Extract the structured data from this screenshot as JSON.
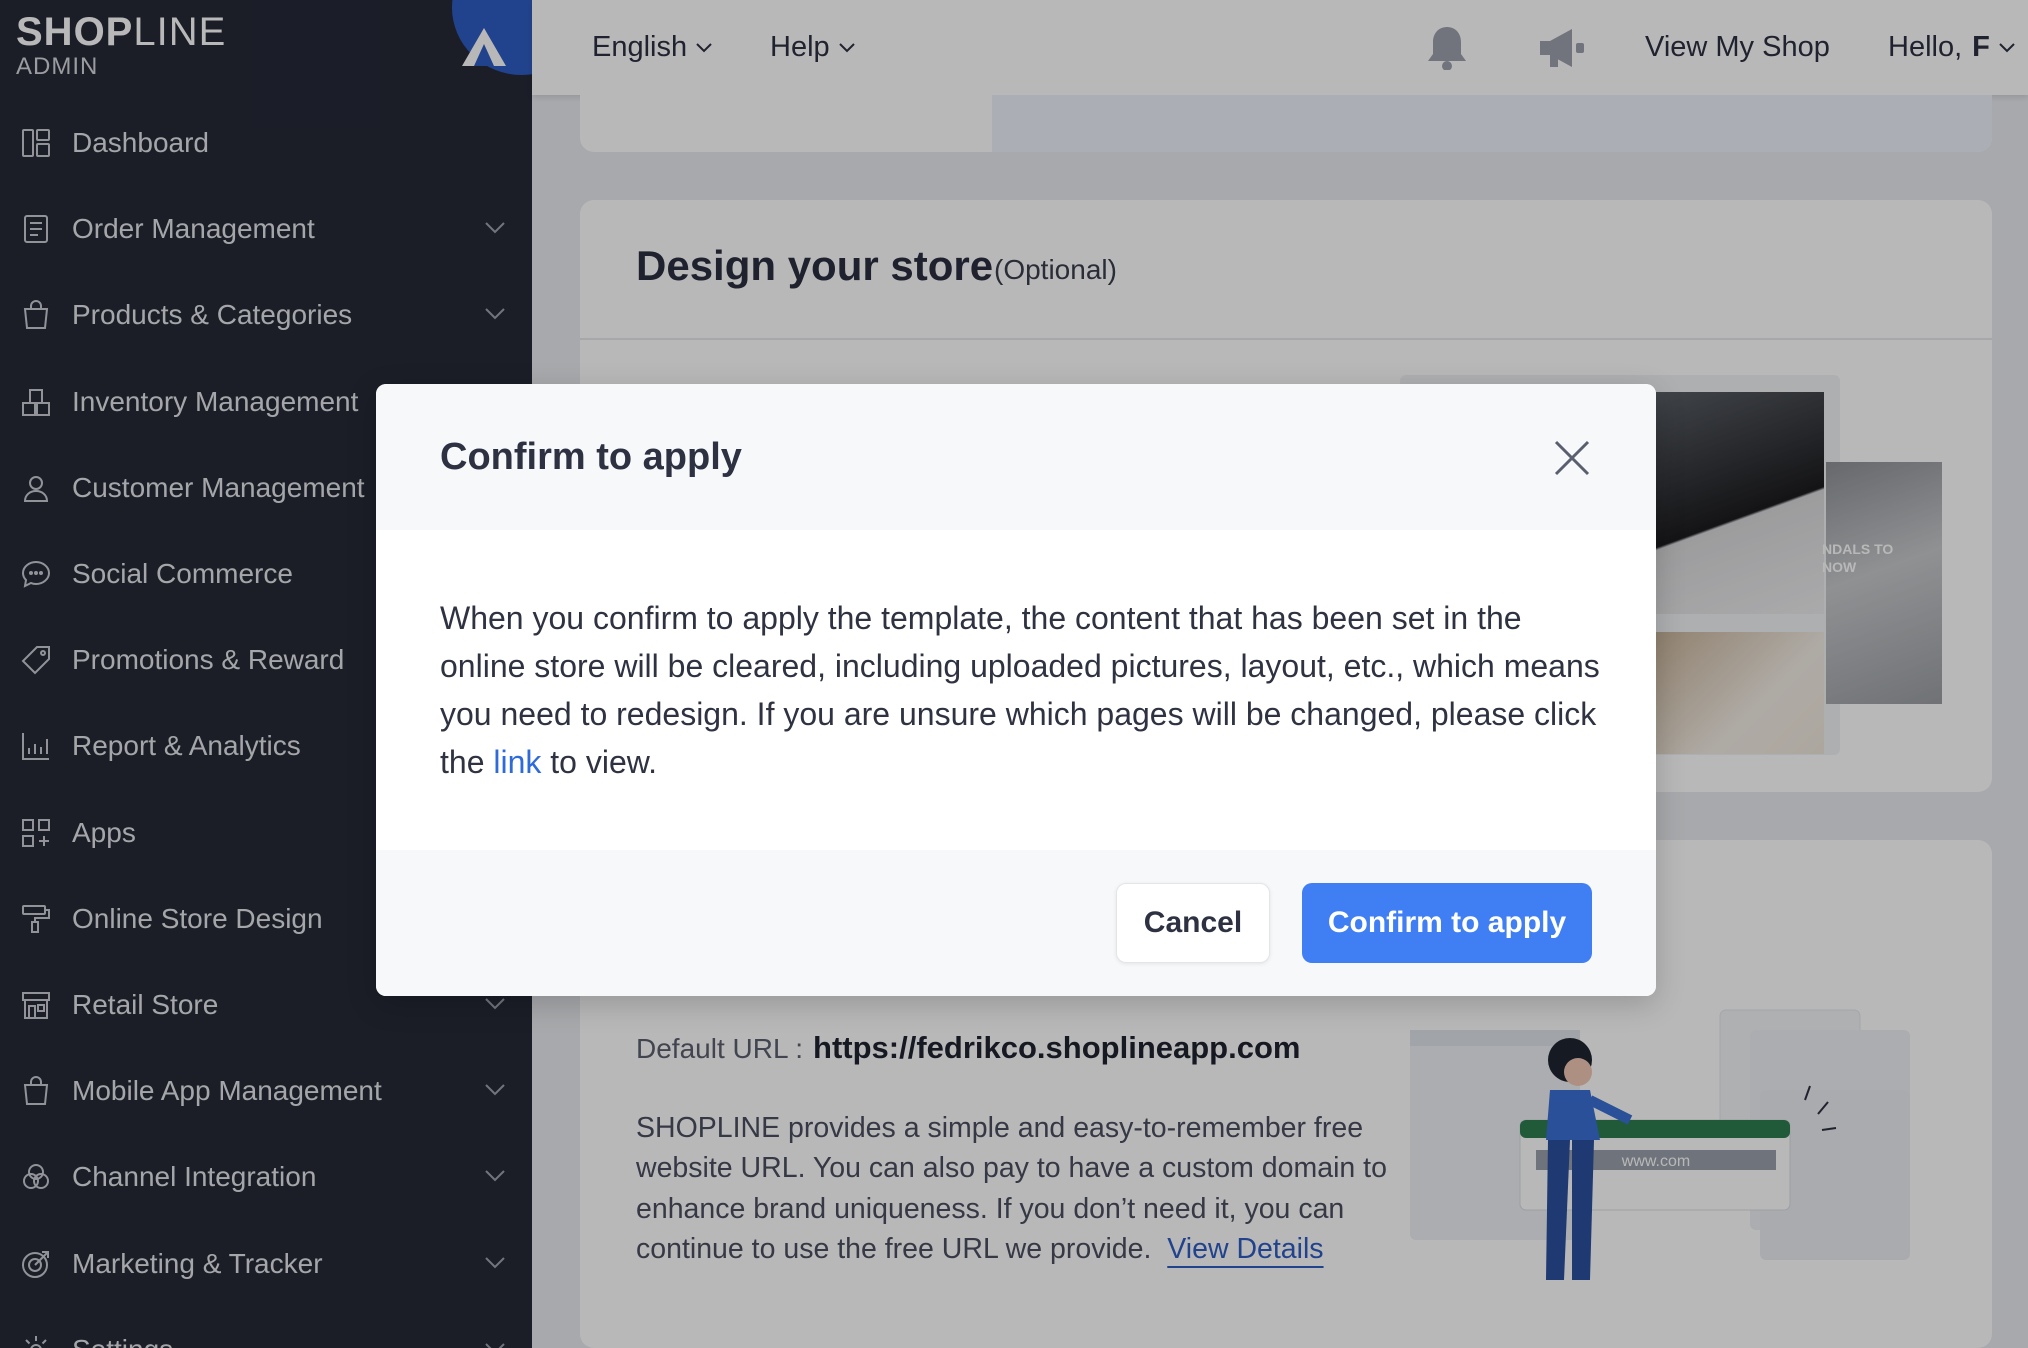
{
  "sidebar": {
    "logo": {
      "main_bold": "SHOP",
      "main_light": "LINE",
      "sub": "ADMIN"
    },
    "items": [
      {
        "label": "Dashboard",
        "icon": "dashboard-icon",
        "expandable": false
      },
      {
        "label": "Order Management",
        "icon": "document-icon",
        "expandable": true
      },
      {
        "label": "Products & Categories",
        "icon": "bag-icon",
        "expandable": true
      },
      {
        "label": "Inventory Management",
        "icon": "boxes-icon",
        "expandable": true
      },
      {
        "label": "Customer Management",
        "icon": "person-icon",
        "expandable": true
      },
      {
        "label": "Social Commerce",
        "icon": "chat-icon",
        "expandable": true
      },
      {
        "label": "Promotions & Reward",
        "icon": "tag-icon",
        "expandable": true
      },
      {
        "label": "Report & Analytics",
        "icon": "analytics-icon",
        "expandable": true
      },
      {
        "label": "Apps",
        "icon": "apps-grid-icon",
        "expandable": false
      },
      {
        "label": "Online Store Design",
        "icon": "paint-roller-icon",
        "expandable": true
      },
      {
        "label": "Retail Store",
        "icon": "store-icon",
        "expandable": true
      },
      {
        "label": "Mobile App Management",
        "icon": "bag-icon",
        "expandable": true
      },
      {
        "label": "Channel Integration",
        "icon": "channels-icon",
        "expandable": true
      },
      {
        "label": "Marketing & Tracker",
        "icon": "target-icon",
        "expandable": true
      },
      {
        "label": "Settings",
        "icon": "gear-icon",
        "expandable": true
      }
    ]
  },
  "topbar": {
    "language": "English",
    "help": "Help",
    "view_shop": "View My Shop",
    "greeting": "Hello,",
    "user_initial": "F"
  },
  "design_card": {
    "title": "Design your store",
    "optional": "(Optional)",
    "preview_caption": "NDALS TO NOW"
  },
  "url_card": {
    "label": "Default URL :",
    "value": "https://fedrikco.shoplineapp.com",
    "description": "SHOPLINE provides a simple and easy-to-remember free website URL. You can also pay to have a custom domain to enhance brand uniqueness. If you don’t need it, you can continue to use the free URL we provide.",
    "link": "View Details",
    "illustration_text": "www.com"
  },
  "modal": {
    "title": "Confirm to apply",
    "body_before": "When you confirm to apply the template, the content that has been set in the online store will be cleared, including uploaded pictures, layout, etc., which means you need to redesign. If you are unsure which pages will be changed, please click the ",
    "body_link": "link",
    "body_after": " to view.",
    "cancel": "Cancel",
    "confirm": "Confirm to apply"
  },
  "colors": {
    "sidebar": "#262a37",
    "accent": "#3f7ef3",
    "link": "#2f6bd8"
  }
}
